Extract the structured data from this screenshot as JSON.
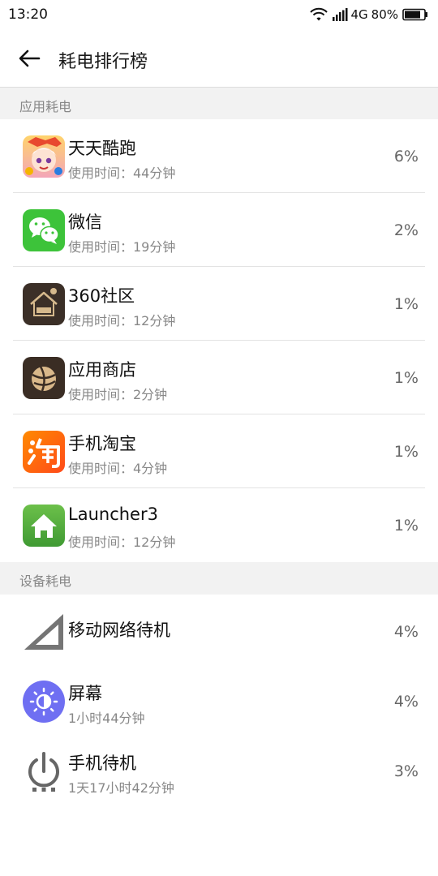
{
  "status_bar": {
    "time": "13:20",
    "network": "4G",
    "battery": "80%",
    "icons": [
      "wifi-icon",
      "signal-icon",
      "battery-icon"
    ]
  },
  "toolbar": {
    "title": "耗电排行榜",
    "back_icon": "back-arrow-icon"
  },
  "sections": {
    "apps_header": "应用耗电",
    "device_header": "设备耗电"
  },
  "apps": [
    {
      "name": "天天酷跑",
      "usage": "使用时间：44分钟",
      "percent": "6%",
      "icon": "tiantian-kupao-icon"
    },
    {
      "name": "微信",
      "usage": "使用时间：19分钟",
      "percent": "2%",
      "icon": "wechat-icon"
    },
    {
      "name": "360社区",
      "usage": "使用时间：12分钟",
      "percent": "1%",
      "icon": "360-community-icon"
    },
    {
      "name": "应用商店",
      "usage": "使用时间：2分钟",
      "percent": "1%",
      "icon": "app-store-icon"
    },
    {
      "name": "手机淘宝",
      "usage": "使用时间：4分钟",
      "percent": "1%",
      "icon": "taobao-icon"
    },
    {
      "name": "Launcher3",
      "usage": "使用时间：12分钟",
      "percent": "1%",
      "icon": "launcher-home-icon"
    }
  ],
  "devices": [
    {
      "name": "移动网络待机",
      "usage": "",
      "percent": "4%",
      "icon": "cell-signal-icon"
    },
    {
      "name": "屏幕",
      "usage": "1小时44分钟",
      "percent": "4%",
      "icon": "brightness-icon"
    },
    {
      "name": "手机待机",
      "usage": "1天17小时42分钟",
      "percent": "3%",
      "icon": "power-standby-icon"
    }
  ],
  "colors": {
    "section_bg": "#f2f2f2",
    "secondary_text": "#888888",
    "wechat_green": "#3dc33a",
    "taobao_orange": "#ff5a14",
    "launcher_green": "#4caf50",
    "brightness_purple": "#6f6ff2"
  }
}
